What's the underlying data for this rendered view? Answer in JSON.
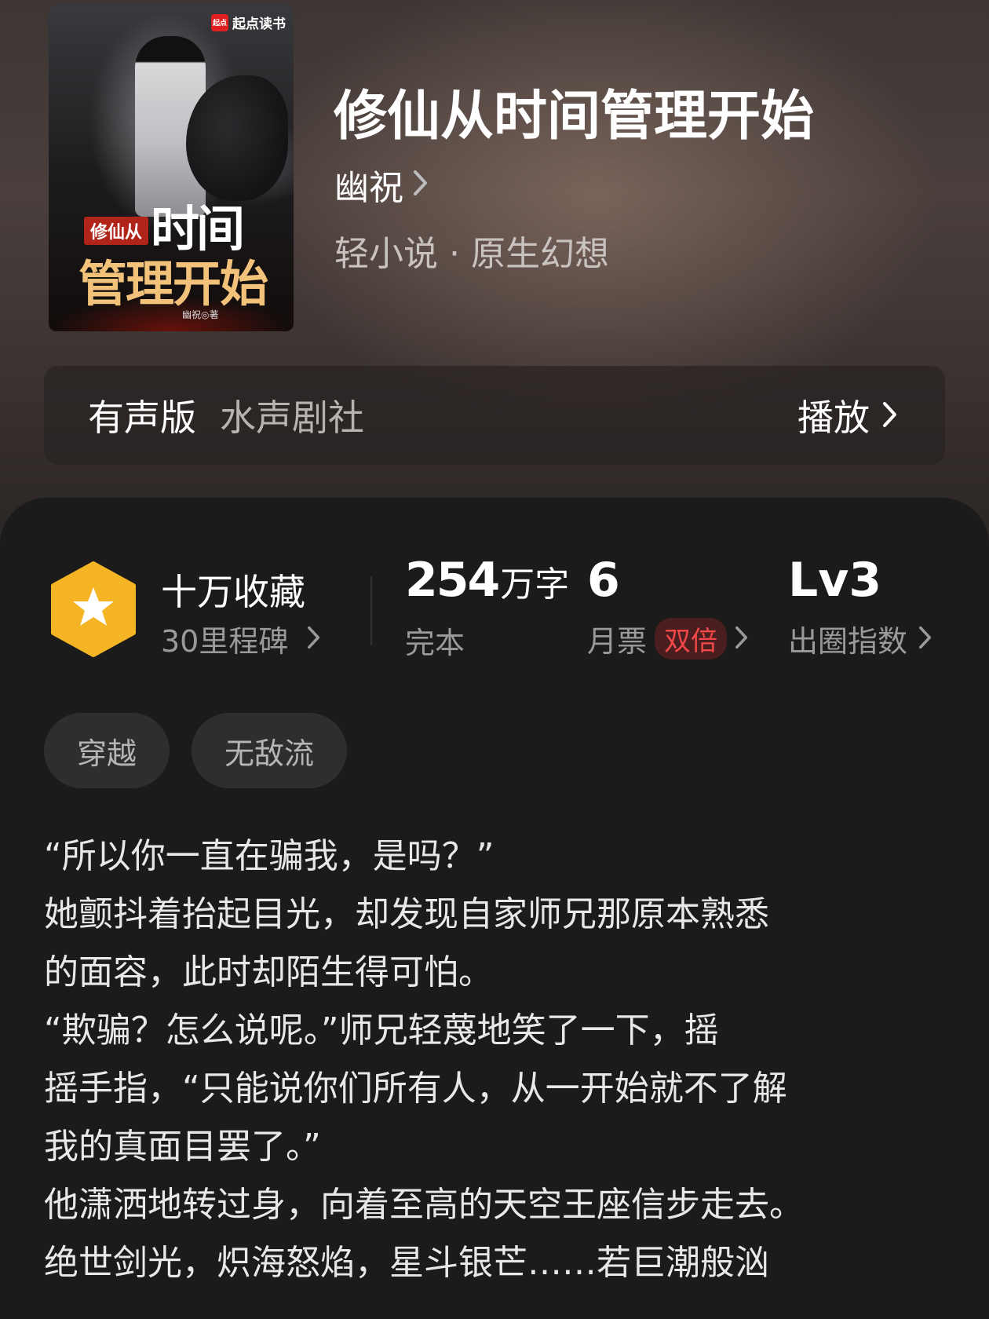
{
  "book": {
    "cover": {
      "brand": "起点读书",
      "title_line1": "修仙从",
      "title_line2": "时间",
      "title_line3": "管理开始",
      "author_mark": "幽祝◎著"
    },
    "title": "修仙从时间管理开始",
    "author": "幽祝",
    "genre": "轻小说 · 原生幻想"
  },
  "audio": {
    "label": "有声版",
    "source": "水声剧社",
    "play": "播放"
  },
  "stats": {
    "favorites": {
      "title": "十万收藏",
      "subtitle": "30里程碑"
    },
    "words": {
      "number": "254",
      "unit": "万字",
      "status": "完本"
    },
    "votes": {
      "value": "6",
      "label": "月票",
      "badge": "双倍"
    },
    "level": {
      "value": "Lv3",
      "label": "出圈指数"
    }
  },
  "tags": [
    "穿越",
    "无敌流"
  ],
  "synopsis": [
    "“所以你一直在骗我，是吗？”",
    "她颤抖着抬起目光，却发现自家师兄那原本熟悉",
    "的面容，此时却陌生得可怕。",
    "“欺骗？怎么说呢。”师兄轻蔑地笑了一下，摇",
    "摇手指，“只能说你们所有人，从一开始就不了解",
    "我的真面目罢了。”",
    "他潇洒地转过身，向着至高的天空王座信步走去。",
    "绝世剑光，炽海怒焰，星斗银芒……若巨潮般汹"
  ],
  "colors": {
    "background": "#1b1b1b",
    "accent_red": "#f04848",
    "badge_gold": "#f5b423"
  }
}
